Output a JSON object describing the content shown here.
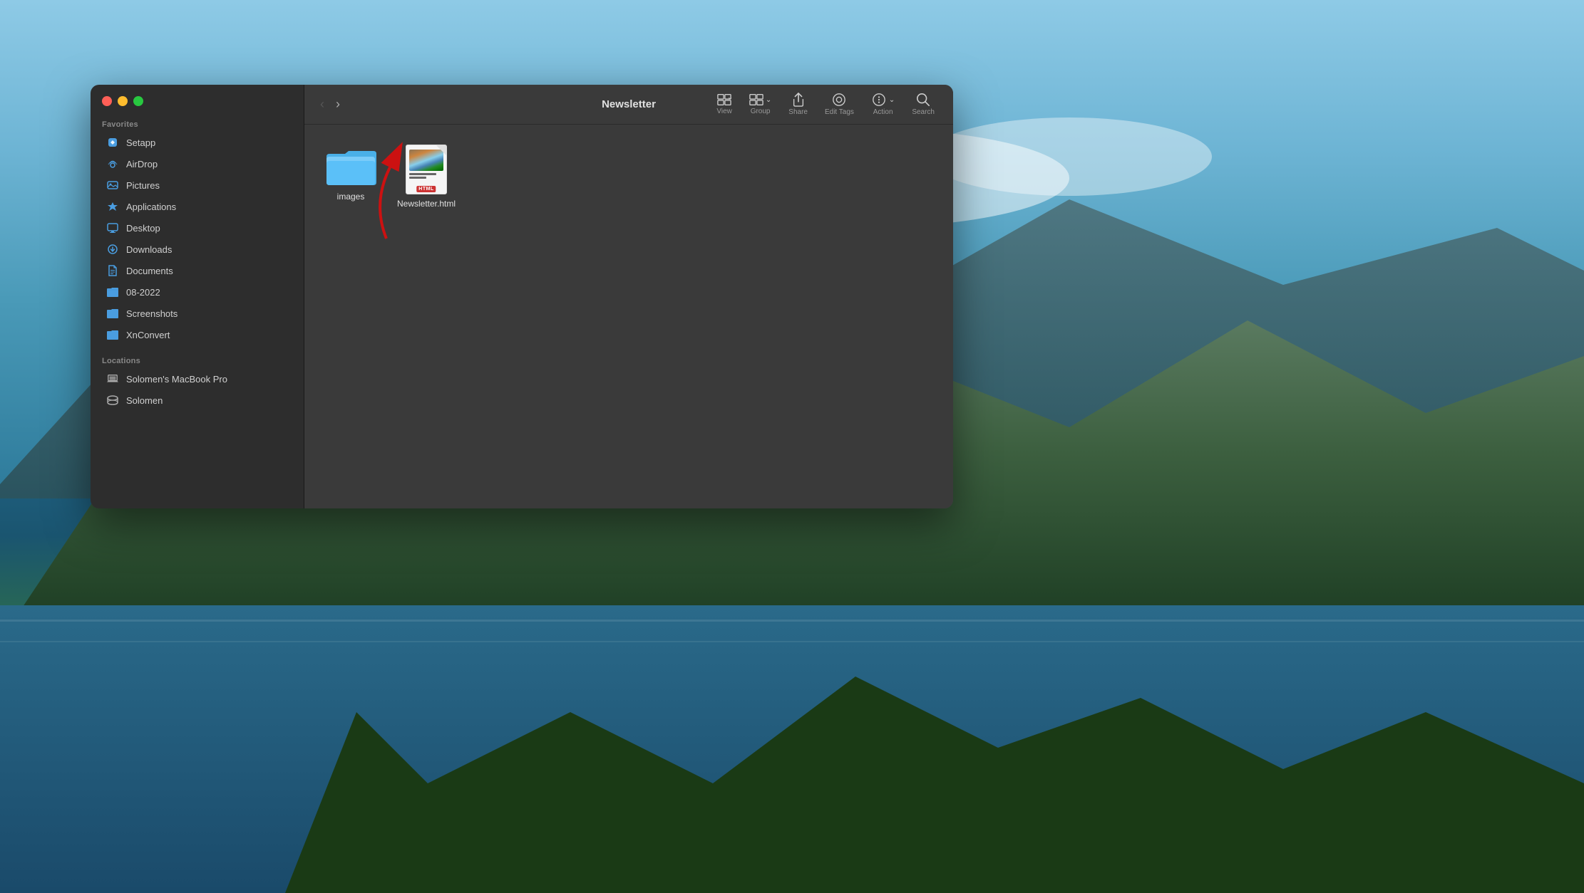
{
  "desktop": {
    "bg_description": "macOS Big Sur mountain lake background"
  },
  "finder": {
    "title": "Newsletter",
    "toolbar": {
      "back_label": "‹",
      "forward_label": "›",
      "back_forward_label": "Back/Forward",
      "view_label": "View",
      "group_label": "Group",
      "share_label": "Share",
      "edit_tags_label": "Edit Tags",
      "action_label": "Action",
      "search_label": "Search"
    },
    "sidebar": {
      "favorites_label": "Favorites",
      "locations_label": "Locations",
      "items": [
        {
          "id": "setapp",
          "label": "Setapp",
          "icon": "setapp"
        },
        {
          "id": "airdrop",
          "label": "AirDrop",
          "icon": "airdrop"
        },
        {
          "id": "pictures",
          "label": "Pictures",
          "icon": "pictures"
        },
        {
          "id": "applications",
          "label": "Applications",
          "icon": "applications"
        },
        {
          "id": "desktop",
          "label": "Desktop",
          "icon": "desktop"
        },
        {
          "id": "downloads",
          "label": "Downloads",
          "icon": "downloads"
        },
        {
          "id": "documents",
          "label": "Documents",
          "icon": "documents"
        },
        {
          "id": "08-2022",
          "label": "08-2022",
          "icon": "folder"
        },
        {
          "id": "screenshots",
          "label": "Screenshots",
          "icon": "folder"
        },
        {
          "id": "xnconvert",
          "label": "XnConvert",
          "icon": "folder"
        }
      ],
      "location_items": [
        {
          "id": "macbook",
          "label": "Solomen's MacBook Pro",
          "icon": "laptop"
        },
        {
          "id": "solomen",
          "label": "Solomen",
          "icon": "drive"
        }
      ]
    },
    "files": [
      {
        "id": "images",
        "name": "images",
        "type": "folder"
      },
      {
        "id": "newsletter-html",
        "name": "Newsletter.html",
        "type": "html"
      }
    ]
  },
  "traffic_lights": {
    "close": "close-button",
    "minimize": "minimize-button",
    "maximize": "maximize-button"
  }
}
